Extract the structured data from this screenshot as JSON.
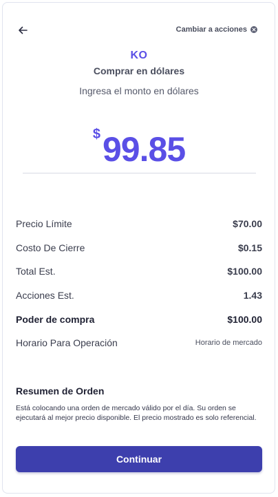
{
  "header": {
    "back_icon": "arrow-left-icon",
    "switch_label": "Cambiar a acciones",
    "switch_icon": "close-circle-icon"
  },
  "ticker": "KO",
  "subtitle": "Comprar en dólares",
  "prompt": "Ingresa el monto en dólares",
  "amount": {
    "currency_symbol": "$",
    "value": "99.85"
  },
  "details": [
    {
      "label": "Precio Límite",
      "value": "$70.00"
    },
    {
      "label": "Costo De Cierre",
      "value": "$0.15"
    },
    {
      "label": "Total Est.",
      "value": "$100.00"
    },
    {
      "label": "Acciones Est.",
      "value": "1.43"
    },
    {
      "label": "Poder de compra",
      "value": "$100.00"
    },
    {
      "label": "Horario Para Operación",
      "value": "Horario de mercado"
    }
  ],
  "summary": {
    "title": "Resumen de Orden",
    "text": "Está colocando una orden de mercado válido por el día. Su orden se ejecutará al mejor precio disponible. El precio mostrado es solo referencial."
  },
  "continue_label": "Continuar",
  "colors": {
    "accent": "#5a4fe6",
    "button": "#3d3fad"
  }
}
